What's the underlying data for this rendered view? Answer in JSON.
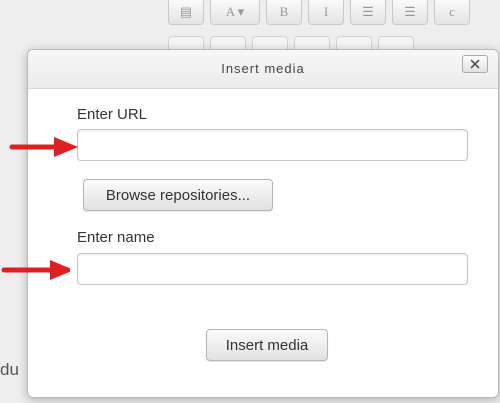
{
  "background": {
    "toolbar_buttons": [
      "▤",
      "A ▾",
      "B",
      "I",
      "☰",
      "☰",
      "c"
    ],
    "partial_text": "du"
  },
  "dialog": {
    "title": "Insert media",
    "close_label": "✕",
    "url_label": "Enter URL",
    "url_value": "",
    "browse_button": "Browse repositories...",
    "name_label": "Enter name",
    "name_value": "",
    "insert_button": "Insert media"
  },
  "colors": {
    "arrow": "#e02020"
  }
}
